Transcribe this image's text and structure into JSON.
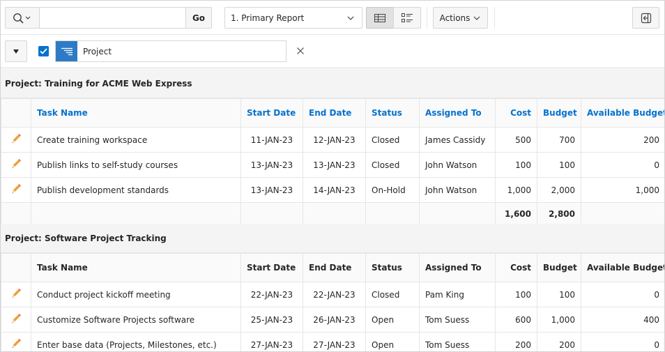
{
  "toolbar": {
    "search_placeholder": "",
    "go_label": "Go",
    "report_select_value": "1. Primary Report",
    "actions_label": "Actions"
  },
  "filter": {
    "checked": true,
    "label": "Project"
  },
  "columns": [
    "Task Name",
    "Start Date",
    "End Date",
    "Status",
    "Assigned To",
    "Cost",
    "Budget",
    "Available Budget"
  ],
  "groups": [
    {
      "title": "Project: Training for ACME Web Express",
      "rows": [
        {
          "task": "Create training workspace",
          "start": "11-JAN-23",
          "end": "12-JAN-23",
          "status": "Closed",
          "assigned": "James Cassidy",
          "cost": "500",
          "budget": "700",
          "available": "200"
        },
        {
          "task": "Publish links to self-study courses",
          "start": "13-JAN-23",
          "end": "13-JAN-23",
          "status": "Closed",
          "assigned": "John Watson",
          "cost": "100",
          "budget": "100",
          "available": "0"
        },
        {
          "task": "Publish development standards",
          "start": "13-JAN-23",
          "end": "14-JAN-23",
          "status": "On-Hold",
          "assigned": "John Watson",
          "cost": "1,000",
          "budget": "2,000",
          "available": "1,000"
        }
      ],
      "totals": {
        "cost": "1,600",
        "budget": "2,800"
      }
    },
    {
      "title": "Project: Software Project Tracking",
      "rows": [
        {
          "task": "Conduct project kickoff meeting",
          "start": "22-JAN-23",
          "end": "22-JAN-23",
          "status": "Closed",
          "assigned": "Pam King",
          "cost": "100",
          "budget": "100",
          "available": "0"
        },
        {
          "task": "Customize Software Projects software",
          "start": "25-JAN-23",
          "end": "26-JAN-23",
          "status": "Open",
          "assigned": "Tom Suess",
          "cost": "600",
          "budget": "1,000",
          "available": "400"
        },
        {
          "task": "Enter base data (Projects, Milestones, etc.)",
          "start": "27-JAN-23",
          "end": "27-JAN-23",
          "status": "Open",
          "assigned": "Tom Suess",
          "cost": "200",
          "budget": "200",
          "available": "0"
        }
      ]
    }
  ],
  "icons": {
    "search": "search-icon",
    "edit": "pencil-icon",
    "grid_view": "grid-view-icon",
    "detail_view": "detail-view-icon",
    "reset": "reset-icon",
    "collapse": "caret-down-icon",
    "filter": "filter-lines-icon",
    "close": "close-icon"
  },
  "colors": {
    "link_blue": "#0572ce",
    "chip_blue": "#2d7bc7",
    "pencil_orange": "#f0a03c"
  }
}
